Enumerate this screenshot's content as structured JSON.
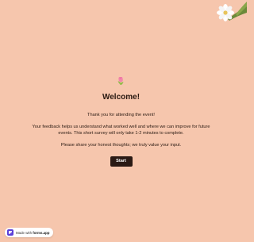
{
  "welcome": {
    "emoji": "🌷",
    "title": "Welcome!",
    "thanks": "Thank you for attending the event!",
    "description": "Your feedback helps us understand what worked well and where we can improve for future events. This short survey will only take 1-2 minutes to complete.",
    "request": "Please share your honest thoughts; we truly value your input.",
    "start_label": "Start"
  },
  "badge": {
    "prefix": "Made with",
    "brand": "forms.app"
  },
  "colors": {
    "background": "#f6c6ad",
    "button": "#2b1a14",
    "badge_logo": "#5a3fd8"
  }
}
